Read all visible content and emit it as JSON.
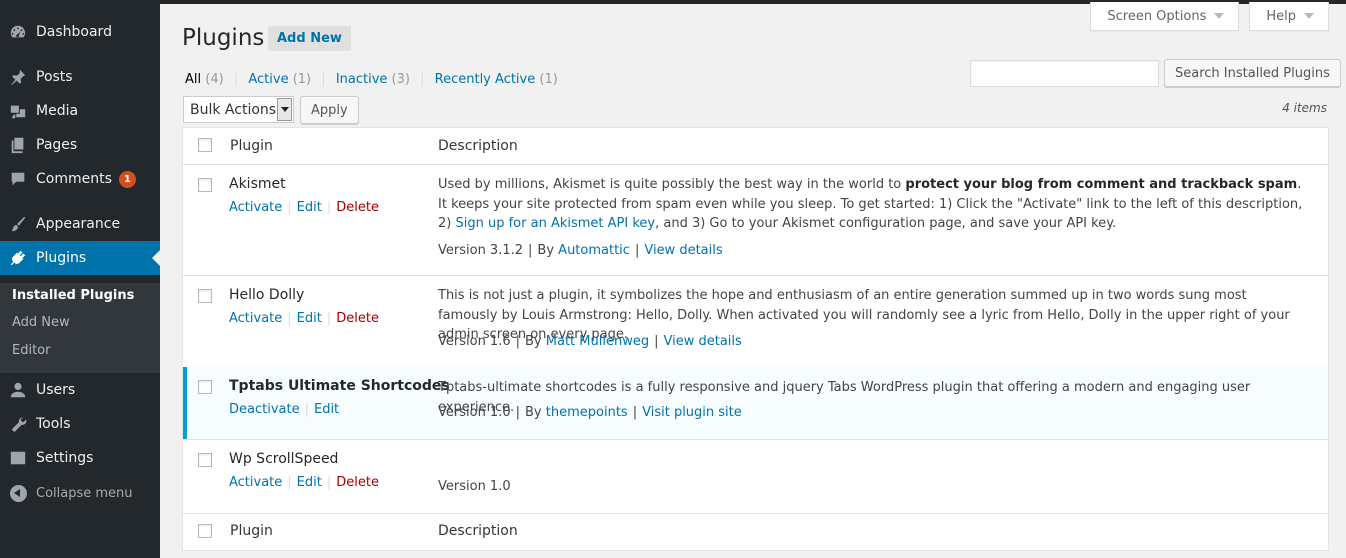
{
  "sidebar": {
    "items": [
      {
        "label": "Dashboard",
        "icon": "dashboard-icon"
      },
      {
        "label": "Posts",
        "icon": "pin-icon"
      },
      {
        "label": "Media",
        "icon": "media-icon"
      },
      {
        "label": "Pages",
        "icon": "pages-icon"
      },
      {
        "label": "Comments",
        "icon": "comment-icon",
        "badge": "1"
      },
      {
        "label": "Appearance",
        "icon": "brush-icon"
      },
      {
        "label": "Plugins",
        "icon": "plugin-icon",
        "active": true
      },
      {
        "label": "Users",
        "icon": "users-icon"
      },
      {
        "label": "Tools",
        "icon": "wrench-icon"
      },
      {
        "label": "Settings",
        "icon": "settings-icon"
      }
    ],
    "submenu": [
      "Installed Plugins",
      "Add New",
      "Editor"
    ],
    "collapse_label": "Collapse menu"
  },
  "screen_tabs": {
    "screen_options": "Screen Options",
    "help": "Help"
  },
  "header": {
    "title": "Plugins",
    "add_new": "Add New"
  },
  "filters": {
    "all": {
      "label": "All",
      "count": "(4)"
    },
    "active": {
      "label": "Active",
      "count": "(1)"
    },
    "inactive": {
      "label": "Inactive",
      "count": "(3)"
    },
    "recent": {
      "label": "Recently Active",
      "count": "(1)"
    },
    "separator": "|"
  },
  "search": {
    "button": "Search Installed Plugins",
    "value": ""
  },
  "bulk": {
    "select": "Bulk Actions",
    "apply": "Apply",
    "items_count": "4 items"
  },
  "table": {
    "headers": {
      "plugin": "Plugin",
      "description": "Description"
    },
    "rows": [
      {
        "name": "Akismet",
        "actions": {
          "a1": "Activate",
          "a2": "Edit",
          "a3": "Delete"
        },
        "desc": {
          "p1": "Used by millions, Akismet is quite possibly the best way in the world to ",
          "strong": "protect your blog from comment and trackback spam",
          "p2": ". It keeps your site protected from spam even while you sleep. To get started: 1) Click the \"Activate\" link to the left of this description, 2) ",
          "link": "Sign up for an Akismet API key",
          "p3": ", and 3) Go to your Akismet configuration page, and save your API key."
        },
        "meta": {
          "version": "Version 3.1.2",
          "by": "By",
          "author": "Automattic",
          "link": "View details"
        }
      },
      {
        "name": "Hello Dolly",
        "actions": {
          "a1": "Activate",
          "a2": "Edit",
          "a3": "Delete"
        },
        "desc": "This is not just a plugin, it symbolizes the hope and enthusiasm of an entire generation summed up in two words sung most famously by Louis Armstrong: Hello, Dolly. When activated you will randomly see a lyric from Hello, Dolly in the upper right of your admin screen on every page.",
        "meta": {
          "version": "Version 1.6",
          "by": "By",
          "author": "Matt Mullenweg",
          "link": "View details"
        }
      },
      {
        "name": "Tptabs Ultimate Shortcodes",
        "actions": {
          "a1": "Deactivate",
          "a2": "Edit"
        },
        "desc": "Tptabs-ultimate shortcodes is a fully responsive and jquery Tabs WordPress plugin that offering a modern and engaging user experience.",
        "meta": {
          "version": "Version 1.0",
          "by": "By",
          "author": "themepoints",
          "link": "Visit plugin site"
        },
        "active": true
      },
      {
        "name": "Wp ScrollSpeed",
        "actions": {
          "a1": "Activate",
          "a2": "Edit",
          "a3": "Delete"
        },
        "desc": "",
        "meta": {
          "version": "Version 1.0"
        }
      }
    ]
  },
  "colors": {
    "sidebar_bg": "#23282d",
    "accent": "#0073aa",
    "active_border": "#00a0d2",
    "delete": "#aa0000",
    "badge": "#d54e21"
  }
}
